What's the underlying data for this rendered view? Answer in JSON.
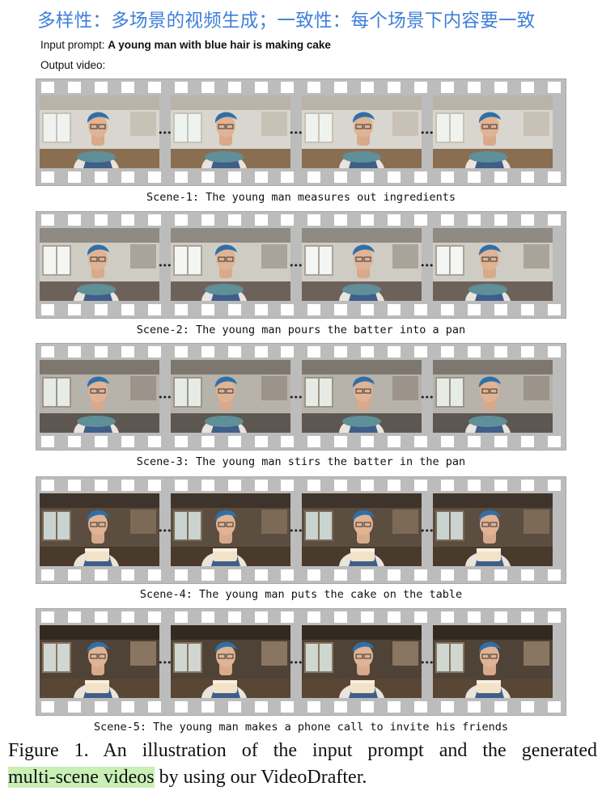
{
  "heading": "多样性：多场景的视频生成；一致性：每个场景下内容要一致",
  "input_prompt": {
    "label": "Input prompt: ",
    "text": "A young man with blue hair is making cake"
  },
  "output_label": "Output video:",
  "scenes": [
    {
      "caption": "Scene-1: The young man measures out ingredients",
      "setting": "kitchen-light"
    },
    {
      "caption": "Scene-2: The young man pours the batter into a pan",
      "setting": "kitchen-window"
    },
    {
      "caption": "Scene-3: The young man stirs the batter in the pan",
      "setting": "kitchen-grey"
    },
    {
      "caption": "Scene-4: The young man puts the cake on the table",
      "setting": "dining-dark"
    },
    {
      "caption": "Scene-5: The young man makes a phone call to invite his friends",
      "setting": "dining-window"
    }
  ],
  "frame_separator": "•••",
  "figure_caption": {
    "prefix": "Figure 1.  An illustration of the input prompt and the generated",
    "highlight": "multi-scene videos",
    "suffix": " by using our VideoDrafter."
  },
  "colors": {
    "heading": "#3d7fd9",
    "highlight": "#c9efb5",
    "film": "#bcbcbc",
    "hair": "#2f6fa8"
  }
}
